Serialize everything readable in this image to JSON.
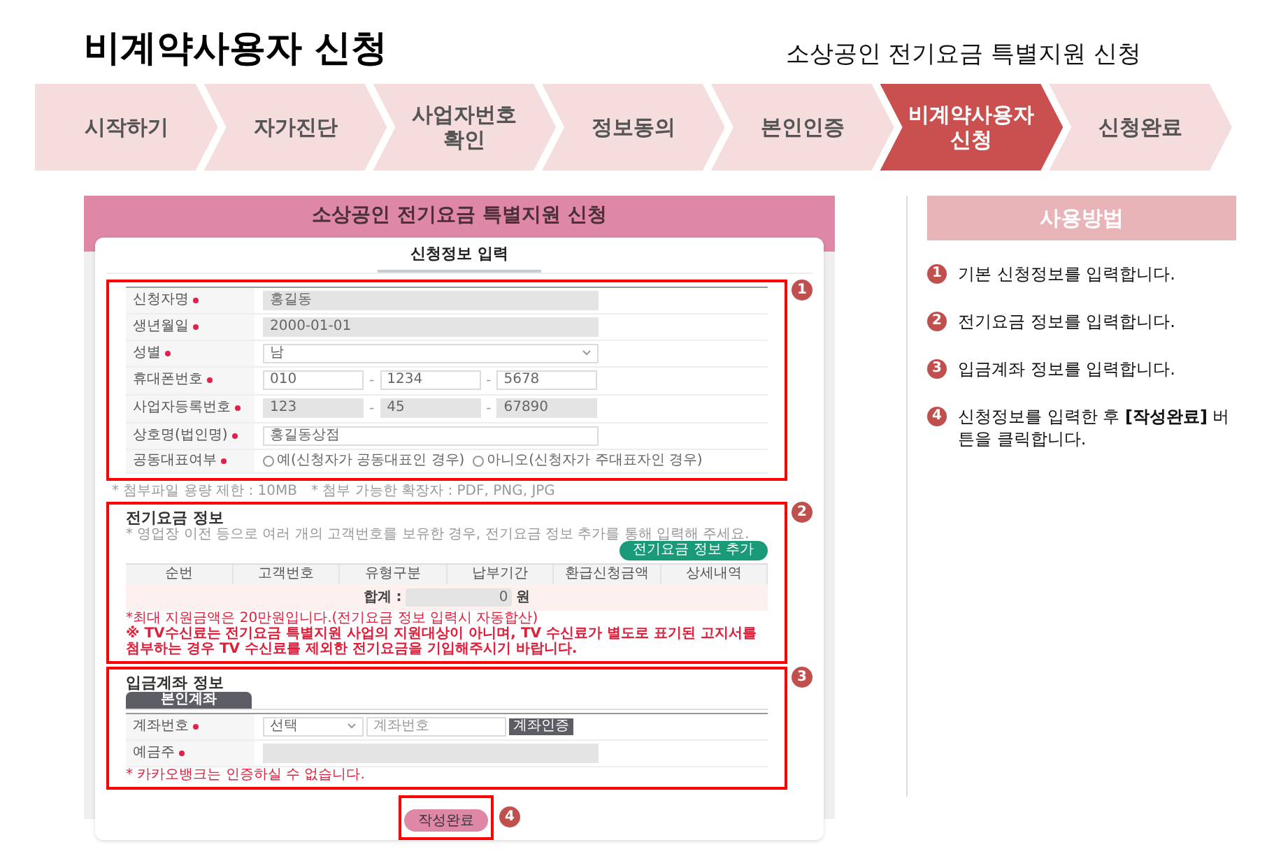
{
  "page_title": "비계약사용자 신청",
  "page_subtitle": "소상공인 전기요금 특별지원 신청",
  "steps": [
    {
      "lines": [
        "시작하기"
      ],
      "selected": false
    },
    {
      "lines": [
        "자가진단"
      ],
      "selected": false
    },
    {
      "lines": [
        "사업자번호",
        "확인"
      ],
      "selected": false
    },
    {
      "lines": [
        "정보동의"
      ],
      "selected": false
    },
    {
      "lines": [
        "본인인증"
      ],
      "selected": false
    },
    {
      "lines": [
        "비계약사용자",
        "신청"
      ],
      "selected": true
    },
    {
      "lines": [
        "신청완료"
      ],
      "selected": false
    }
  ],
  "form": {
    "banner_title": "소상공인 전기요금 특별지원 신청",
    "card_title": "신청정보 입력",
    "applicant": {
      "marker": "1",
      "rows": [
        {
          "kind": "text",
          "label": "신청자명",
          "required": true,
          "disabled": true,
          "values": [
            "홍길동"
          ]
        },
        {
          "kind": "text",
          "label": "생년월일",
          "required": true,
          "disabled": true,
          "values": [
            "2000-01-01"
          ]
        },
        {
          "kind": "select",
          "label": "성별",
          "required": true,
          "disabled": false,
          "values": [
            "남"
          ]
        },
        {
          "kind": "triple",
          "label": "휴대폰번호",
          "required": true,
          "disabled": false,
          "values": [
            "010",
            "1234",
            "5678"
          ],
          "separator": "-"
        },
        {
          "kind": "triple",
          "label": "사업자등록번호",
          "required": true,
          "disabled": true,
          "values": [
            "123",
            "45",
            "67890"
          ],
          "separator": "-"
        },
        {
          "kind": "text",
          "label": "상호명(법인명)",
          "required": true,
          "disabled": false,
          "values": [
            "홍길동상점"
          ]
        },
        {
          "kind": "radio",
          "label": "공동대표여부",
          "required": true,
          "options": [
            {
              "label": "예(신청자가 공동대표인 경우)",
              "selected": false
            },
            {
              "label": "아니오(신청자가 주대표자인 경우)",
              "selected": false
            }
          ]
        }
      ]
    },
    "file_notes": [
      "* 첨부파일 용량 제한 : 10MB",
      "* 첨부 가능한 확장자 : PDF, PNG, JPG"
    ],
    "electricity": {
      "marker": "2",
      "title": "전기요금 정보",
      "hint": "* 영업장 이전 등으로 여러 개의 고객번호를 보유한 경우, 전기요금 정보 추가를 통해 입력해 주세요.",
      "add_button": "전기요금 정보 추가",
      "columns": [
        "순번",
        "고객번호",
        "유형구분",
        "납부기간",
        "환급신청금액",
        "상세내역"
      ],
      "total_label": "합계 :",
      "total_value": "0",
      "total_unit": "원",
      "notes": [
        "*최대 지원금액은 20만원입니다.(전기요금 정보 입력시 자동합산)",
        "※ TV수신료는 전기요금 특별지원 사업의 지원대상이 아니며, TV 수신료가 별도로 표기된 고지서를 첨부하는 경우 TV 수신료를 제외한 전기요금을 기입해주시기 바랍니다."
      ]
    },
    "account": {
      "marker": "3",
      "title": "입금계좌 정보",
      "tabs": [
        {
          "label": "본인계좌",
          "selected": true
        }
      ],
      "bank_label": "계좌번호",
      "bank_select": "선택",
      "account_placeholder": "계좌번호",
      "verify_button": "계좌인증",
      "holder_label": "예금주",
      "note": "* 카카오뱅크는 인증하실 수 없습니다."
    },
    "submit": "작성완료",
    "submit_marker": "4"
  },
  "usage": {
    "title": "사용방법",
    "items": [
      {
        "number": "1",
        "text": "기본 신청정보를 입력합니다."
      },
      {
        "number": "2",
        "text": "전기요금 정보를 입력합니다."
      },
      {
        "number": "3",
        "text": "입금계좌 정보를 입력합니다."
      },
      {
        "number": "4",
        "text": "신청정보를 입력한 후 **[작성완료]** 버튼을 클릭합니다."
      }
    ]
  }
}
